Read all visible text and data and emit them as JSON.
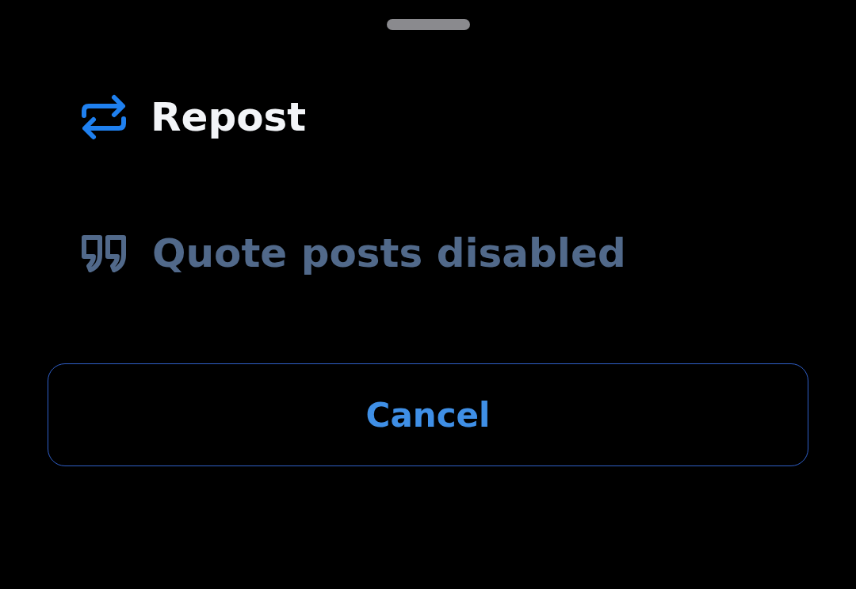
{
  "menu": {
    "items": [
      {
        "kind": "repost",
        "label": "Repost",
        "disabled": false
      },
      {
        "kind": "quote",
        "label": "Quote posts disabled",
        "disabled": true
      }
    ]
  },
  "cancel_button": {
    "label": "Cancel"
  }
}
